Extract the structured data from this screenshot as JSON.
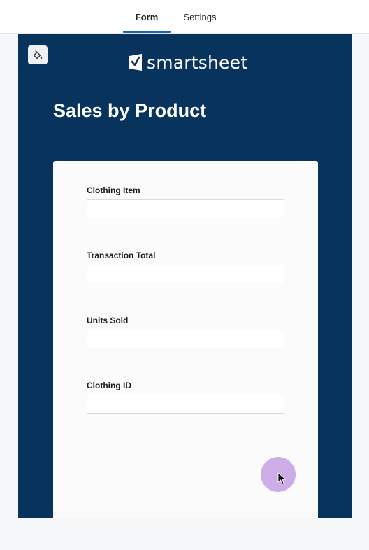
{
  "tabs": [
    {
      "label": "Form",
      "active": true
    },
    {
      "label": "Settings",
      "active": false
    }
  ],
  "colors": {
    "header_bg": "#08335c",
    "tab_active_underline": "#1b63c6",
    "card_bg": "#fbfbfb",
    "cursor_highlight": "#c8a3e6"
  },
  "brand": {
    "logo_text": "smartsheet",
    "logo_icon": "smartsheet-check-icon"
  },
  "form": {
    "title": "Sales by Product",
    "fields": [
      {
        "label": "Clothing Item",
        "value": ""
      },
      {
        "label": "Transaction Total",
        "value": ""
      },
      {
        "label": "Units Sold",
        "value": ""
      },
      {
        "label": "Clothing ID",
        "value": ""
      }
    ]
  },
  "icons": {
    "theme": "paint-bucket-icon",
    "cursor": "mouse-pointer-icon"
  }
}
